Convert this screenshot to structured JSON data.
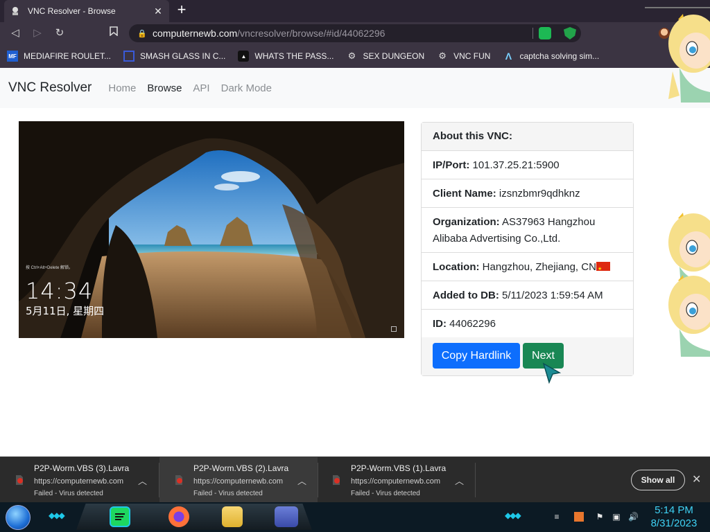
{
  "browser": {
    "tab_title": "VNC Resolver - Browse",
    "tab_close": "✕",
    "new_tab": "+",
    "url_host": "computernewb.com",
    "url_path": "/vncresolver/browse/#id/44062296"
  },
  "bookmarks": [
    {
      "label": "MEDIAFIRE ROULET...",
      "icon": "mediafire-icon"
    },
    {
      "label": "SMASH GLASS IN C...",
      "icon": "bookmark-icon"
    },
    {
      "label": "WHATS THE PASS...",
      "icon": "bookmark-icon"
    },
    {
      "label": "SEX DUNGEON",
      "icon": "globe-icon"
    },
    {
      "label": "VNC FUN",
      "icon": "globe-icon"
    },
    {
      "label": "captcha solving sim...",
      "icon": "a-icon"
    }
  ],
  "site": {
    "brand": "VNC Resolver",
    "nav": [
      "Home",
      "Browse",
      "API",
      "Dark Mode"
    ]
  },
  "vnc_screenshot": {
    "hint": "按 Ctrl+Alt+Delete 解锁。",
    "time": "14:34",
    "date": "5月11日, 星期四"
  },
  "about": {
    "header": "About this VNC:",
    "ip_label": "IP/Port:",
    "ip_value": "101.37.25.21:5900",
    "client_label": "Client Name:",
    "client_value": "izsnzbmr9qdhknz",
    "org_label": "Organization:",
    "org_value": "AS37963 Hangzhou Alibaba Advertising Co.,Ltd.",
    "loc_label": "Location:",
    "loc_value": "Hangzhou, Zhejiang, CN",
    "added_label": "Added to DB:",
    "added_value": "5/11/2023 1:59:54 AM",
    "id_label": "ID:",
    "id_value": "44062296",
    "copy_button": "Copy Hardlink",
    "next_button": "Next"
  },
  "downloads": [
    {
      "name": "P2P-Worm.VBS (3).Lavra",
      "url": "https://computernewb.com",
      "status": "Failed - Virus detected"
    },
    {
      "name": "P2P-Worm.VBS (2).Lavra",
      "url": "https://computernewb.com",
      "status": "Failed - Virus detected"
    },
    {
      "name": "P2P-Worm.VBS (1).Lavra",
      "url": "https://computernewb.com",
      "status": "Failed - Virus detected"
    }
  ],
  "shelf": {
    "show_all": "Show all",
    "close": "✕"
  },
  "taskbar": {
    "time": "5:14 PM",
    "date": "8/31/2023"
  },
  "colors": {
    "primary": "#0d6efd",
    "success": "#198754",
    "clock": "#3fd2f5",
    "chrome": "#3b3442"
  }
}
